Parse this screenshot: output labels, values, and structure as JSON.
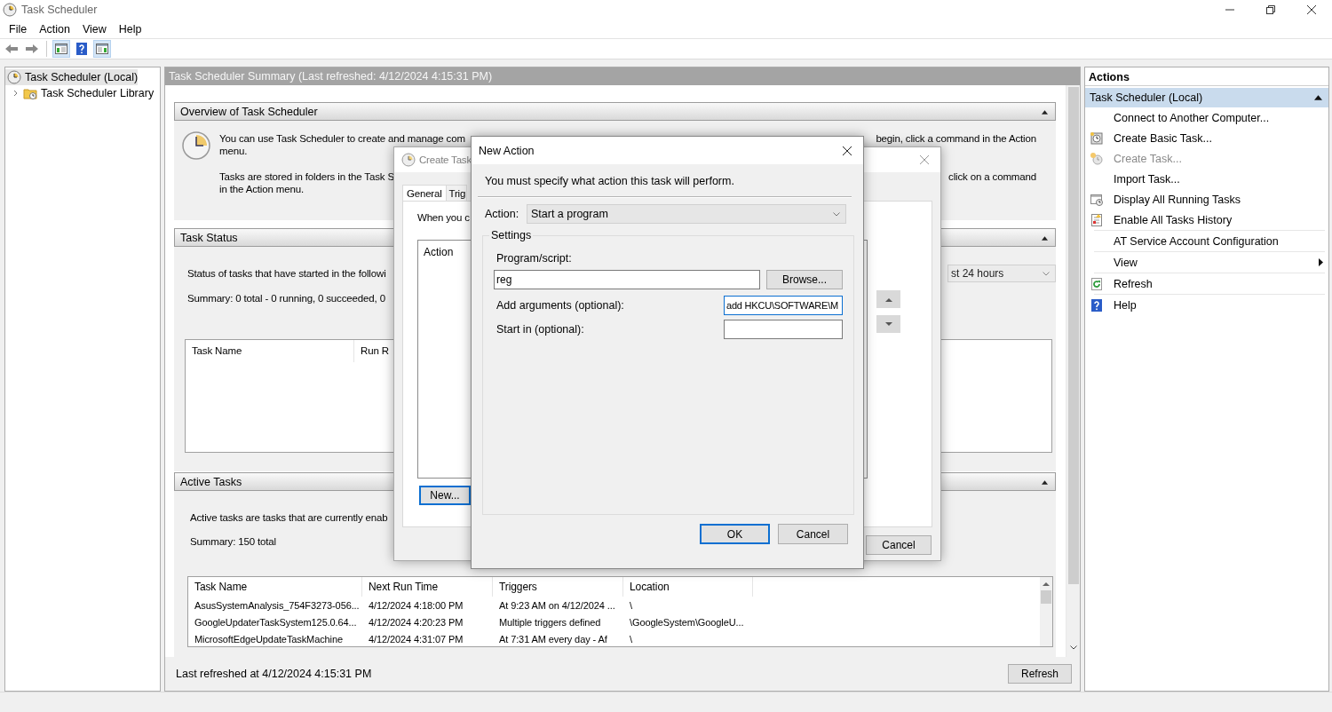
{
  "window": {
    "title": "Task Scheduler"
  },
  "menu": [
    "File",
    "Action",
    "View",
    "Help"
  ],
  "toolbar": [
    {
      "kind": "back",
      "selected": false
    },
    {
      "kind": "forward",
      "selected": false
    },
    {
      "kind": "tree_pane",
      "selected": true
    },
    {
      "kind": "help",
      "selected": false
    },
    {
      "kind": "action_pane",
      "selected": true
    }
  ],
  "tree": [
    {
      "label": "Task Scheduler (Local)",
      "selected": true,
      "expanded": true,
      "children": [
        {
          "label": "Task Scheduler Library",
          "selected": false,
          "expanded": false
        }
      ]
    }
  ],
  "summary": {
    "title": "Task Scheduler Summary (Last refreshed: 4/12/2024 4:15:31 PM)",
    "overview": {
      "title": "Overview of Task Scheduler",
      "expanded": true,
      "paragraphs": [
        [
          {
            "left": "You can use Task Scheduler to create and manage com",
            "right": "begin, click a command in the Action"
          },
          {
            "left": "menu."
          }
        ],
        [
          {
            "left": "Tasks are stored in folders in the Task S",
            "right": "click on a command"
          },
          {
            "left": "in the Action menu."
          }
        ]
      ]
    },
    "task_status": {
      "title": "Task Status",
      "expanded": true,
      "texts": [
        "Status of tasks that have started in the followi",
        "Summary: 0 total - 0 running, 0 succeeded, 0"
      ],
      "period": "st 24 hours",
      "table": {
        "columns": [
          "Task Name",
          "Run R"
        ]
      }
    },
    "active_tasks": {
      "title": "Active Tasks",
      "expanded": true,
      "texts": [
        "Active tasks are tasks that are currently enab",
        "Summary: 150 total"
      ],
      "table": {
        "columns": [
          "Task Name",
          "Next Run Time",
          "Triggers",
          "Location"
        ],
        "rows": [
          [
            "AsusSystemAnalysis_754F3273-056...",
            "4/12/2024 4:18:00 PM",
            "At 9:23 AM on 4/12/2024 ...",
            "\\"
          ],
          [
            "GoogleUpdaterTaskSystem125.0.64...",
            "4/12/2024 4:20:23 PM",
            "Multiple triggers defined",
            "\\GoogleSystem\\GoogleU..."
          ],
          [
            "MicrosoftEdgeUpdateTaskMachine",
            "4/12/2024 4:31:07 PM",
            "At 7:31 AM every day - Af",
            "\\"
          ]
        ]
      }
    },
    "footer": {
      "text": "Last refreshed at 4/12/2024 4:15:31 PM",
      "button": "Refresh"
    }
  },
  "actions_pane": {
    "title": "Actions",
    "group": {
      "label": "Task Scheduler (Local)",
      "expanded": true
    },
    "items": [
      {
        "label": "Connect to Another Computer...",
        "kind": "plain",
        "disabled": false,
        "group_start": false
      },
      {
        "label": "Create Basic Task...",
        "kind": "wizard",
        "disabled": false,
        "group_start": false
      },
      {
        "label": "Create Task...",
        "kind": "task",
        "disabled": true,
        "group_start": false
      },
      {
        "label": "Import Task...",
        "kind": "plain",
        "disabled": false,
        "group_start": false
      },
      {
        "label": "Display All Running Tasks",
        "kind": "running",
        "disabled": false,
        "group_start": false
      },
      {
        "label": "Enable All Tasks History",
        "kind": "history",
        "disabled": false,
        "group_start": false
      },
      {
        "label": "AT Service Account Configuration",
        "kind": "plain",
        "disabled": false,
        "group_start": true
      },
      {
        "label": "View",
        "kind": "submenu",
        "disabled": false,
        "group_start": true
      },
      {
        "label": "Refresh",
        "kind": "refresh",
        "disabled": false,
        "group_start": true
      },
      {
        "label": "Help",
        "kind": "help",
        "disabled": false,
        "group_start": true
      }
    ]
  },
  "create_task_dialog": {
    "title": "Create Task",
    "active": false,
    "tabs": [
      {
        "label": "General",
        "selected": true
      },
      {
        "label": "Trig",
        "selected": false
      }
    ],
    "intro": "When you c",
    "list": {
      "columns": [
        "Action"
      ]
    },
    "new_button": "New...",
    "cancel_button": "Cancel"
  },
  "new_action_dialog": {
    "title": "New Action",
    "active": true,
    "instruction": "You must specify what action this task will perform.",
    "action": {
      "label": "Action:",
      "value": "Start a program"
    },
    "settings": {
      "title": "Settings",
      "program": {
        "label": "Program/script:",
        "value": "reg",
        "button": "Browse..."
      },
      "arguments": {
        "label": "Add arguments (optional):",
        "value": "add HKCU\\SOFTWARE\\M",
        "focused": true
      },
      "start_in": {
        "label": "Start in (optional):",
        "focused": false
      }
    },
    "buttons": [
      {
        "label": "OK",
        "default": true
      },
      {
        "label": "Cancel",
        "default": false
      }
    ]
  }
}
